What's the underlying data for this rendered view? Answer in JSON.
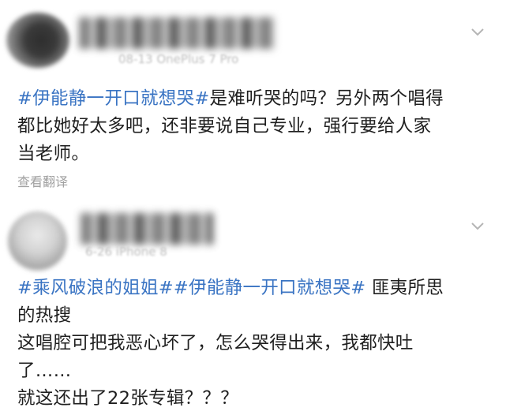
{
  "posts": [
    {
      "username": "",
      "meta": "08-13 OnePlus 7 Pro",
      "lines": [
        {
          "tag": "#伊能静一开口就想哭#",
          "text": "是难听哭的吗？另外两个唱得"
        },
        {
          "text": "都比她好太多吧，还非要说自己专业，强行要给人家"
        },
        {
          "text": "当老师。"
        }
      ],
      "translate_label": "查看翻译"
    },
    {
      "username": "",
      "meta": "6-26 iPhone 8",
      "lines": [
        {
          "tag": "#乘风破浪的姐姐##伊能静一开口就想哭#",
          "text": " 匪夷所思"
        },
        {
          "text": "的热搜"
        },
        {
          "text": "这唱腔可把我恶心坏了，怎么哭得出来，我都快吐"
        },
        {
          "text": "了……"
        },
        {
          "text": "就这还出了22张专辑？？？"
        }
      ]
    }
  ],
  "icons": {
    "post_menu": "chevron-down-icon"
  },
  "colors": {
    "hashtag": "#3a74c3",
    "text": "#1f1f1f",
    "muted": "#a0a0a0"
  }
}
